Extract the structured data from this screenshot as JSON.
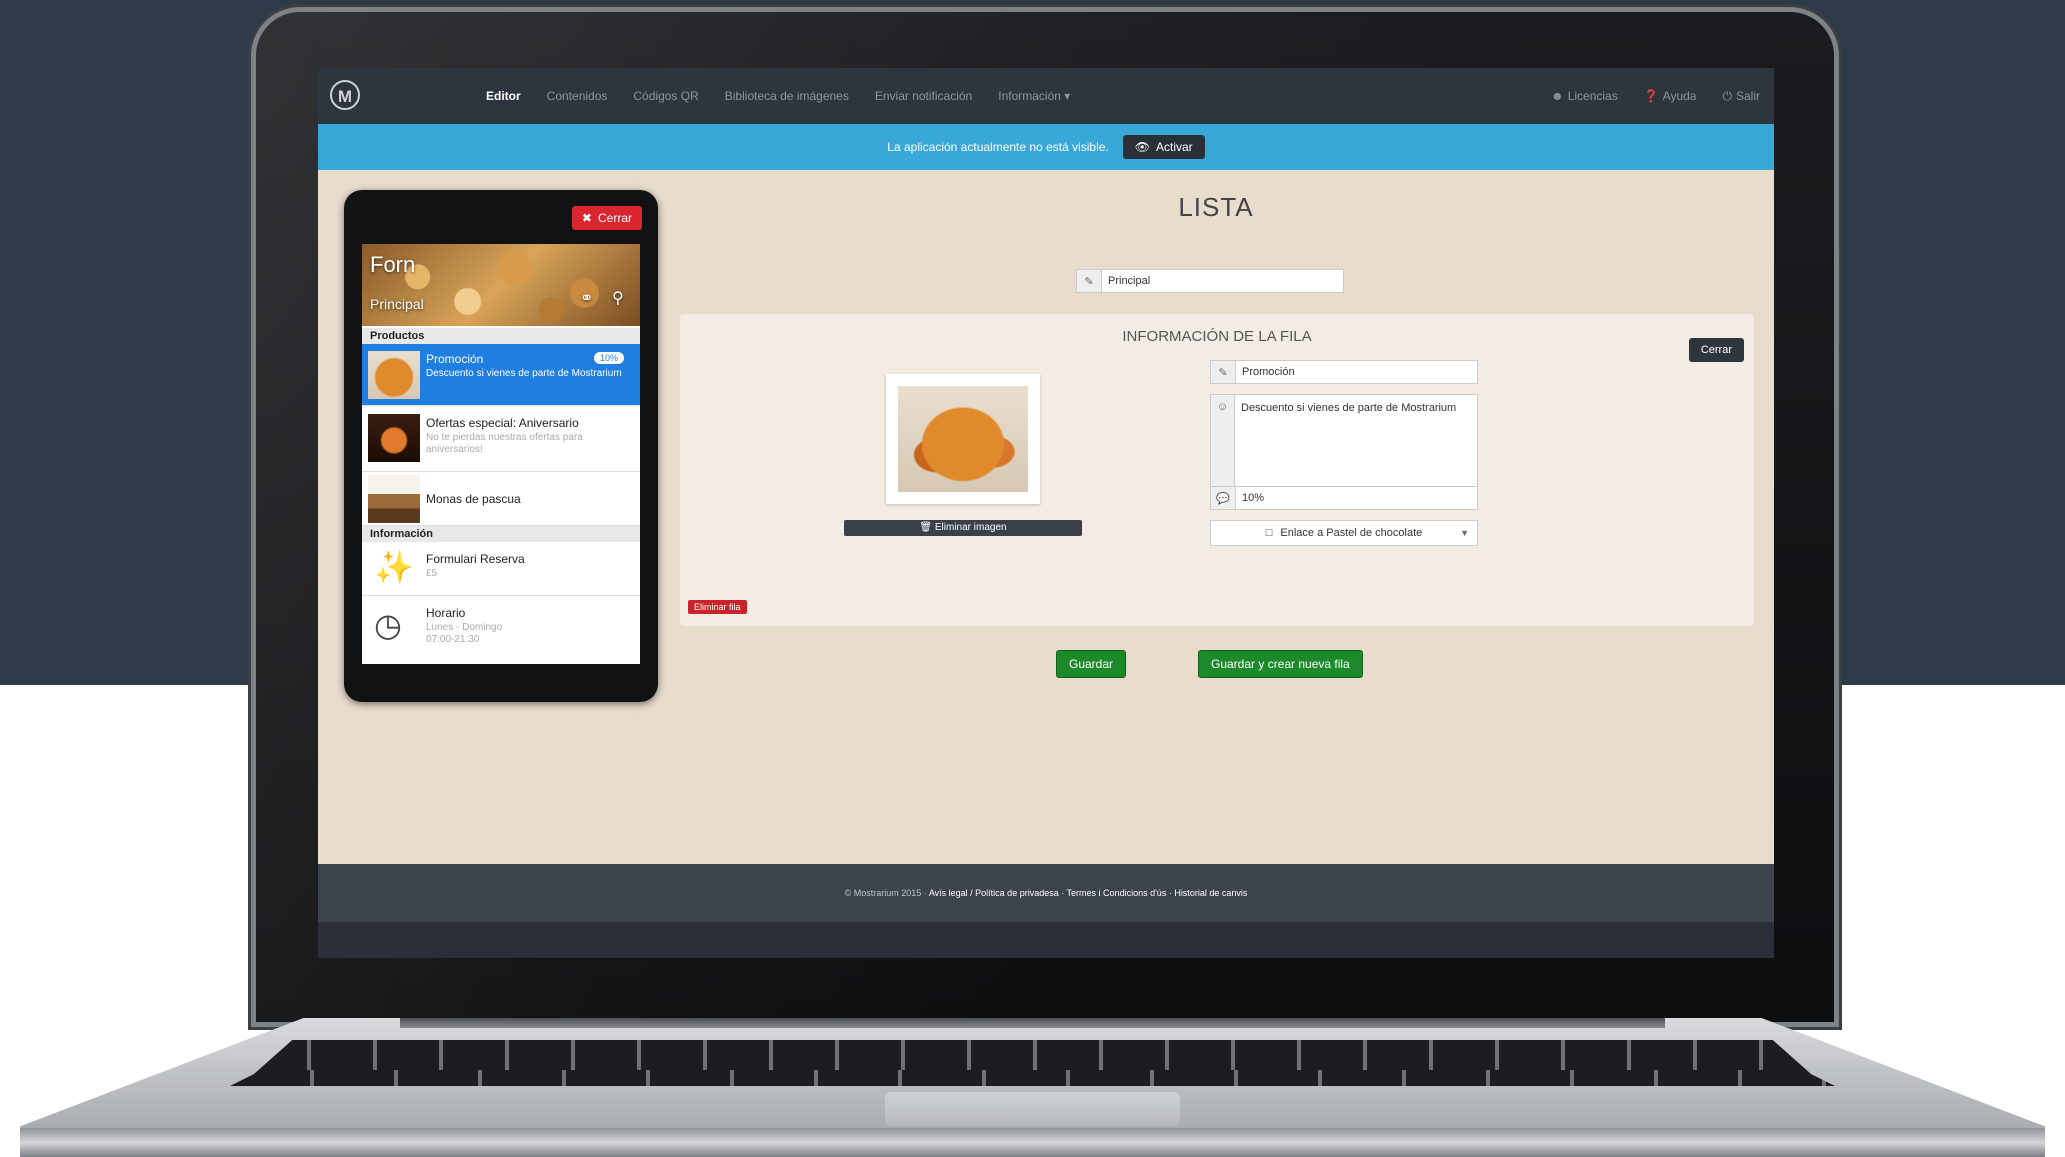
{
  "nav": {
    "items": [
      "Editor",
      "Contenidos",
      "Códigos QR",
      "Biblioteca de imágenes",
      "Enviar notificación",
      "Información ▾"
    ],
    "right": [
      "Licencias",
      "Ayuda",
      "Salir"
    ]
  },
  "alert": {
    "text": "La aplicación actualmente no está visible.",
    "button": "Activar"
  },
  "phone": {
    "close_label": "Cerrar",
    "hero_title": "Forn",
    "hero_subtitle": "Principal",
    "section_products": "Productos",
    "section_info": "Información",
    "rows": [
      {
        "title": "Promoción",
        "subtitle": "Descuento si vienes de parte de Mostrarium",
        "badge": "10%"
      },
      {
        "title": "Ofertas especial: Aniversario",
        "subtitle": "No te pierdas nuestras ofertas para aniversarios!"
      },
      {
        "title": "Monas de pascua",
        "subtitle": ""
      },
      {
        "title": "Formulari Reserva",
        "subtitle": "£5"
      },
      {
        "title": "Horario",
        "subtitle": "Lunes - Domingo 07:00-21:30"
      }
    ]
  },
  "main": {
    "title": "LISTA",
    "name_value": "Principal",
    "panel_title": "INFORMACIÓN DE LA FILA",
    "close_label": "Cerrar",
    "remove_image_label": "Eliminar imagen",
    "row_title_value": "Promoción",
    "row_description_value": "Descuento si vienes de parte de Mostrarium",
    "row_badge_value": "10%",
    "link_select_value": "Enlace a Pastel de chocolate",
    "remove_row_label": "Eliminar fila",
    "save_label": "Guardar",
    "save_new_label": "Guardar y crear nueva fila"
  },
  "footer": {
    "copyright": "© Mostrarium 2015 ·",
    "links": "Avís legal / Política de privadesa · Termes i Condicions d'ús · Historial de canvis"
  },
  "colors": {
    "navbar": "#2f353d",
    "alert": "#3aa7d9",
    "content_bg": "#e8dccd",
    "save_button": "#1c8a2a",
    "danger": "#d9262f"
  }
}
